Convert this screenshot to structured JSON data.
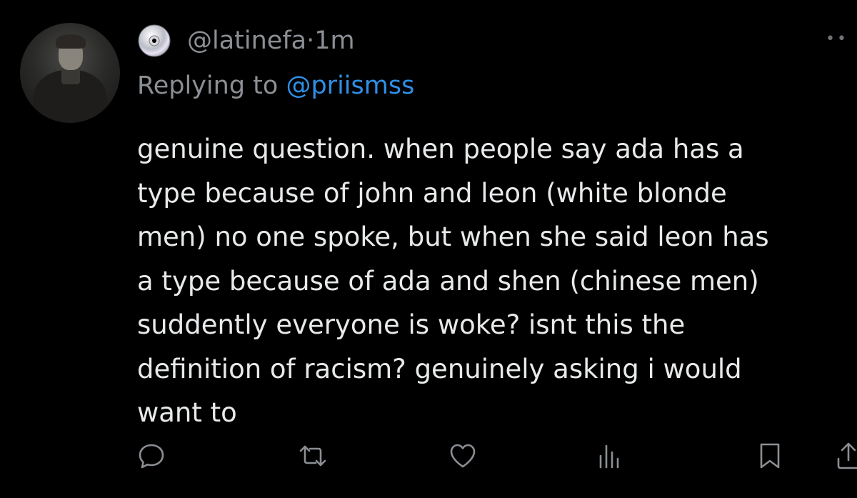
{
  "tweet": {
    "handle": "@latinefa",
    "separator": "·",
    "time": "1m",
    "reply_prefix": "Replying to",
    "reply_to": "@priismss",
    "text": "genuine question. when people say ada has a\ntype because of john and leon (white blonde\nmen) no one spoke, but when she said leon has\na type because of ada and shen (chinese men)\nsuddently everyone is woke? isnt this the\ndefinition of racism? genuinely asking i would\nwant to"
  },
  "icons": {
    "avatar": "profile-photo",
    "badge": "cd-disc-icon",
    "more": "more-icon",
    "reply": "reply-icon",
    "retweet": "retweet-icon",
    "like": "heart-icon",
    "views": "views-icon",
    "bookmark": "bookmark-icon",
    "share": "share-icon"
  },
  "colors": {
    "background": "#000000",
    "text": "#e7e9ea",
    "secondary": "#8b8f94",
    "mention": "#2f8fe6"
  }
}
